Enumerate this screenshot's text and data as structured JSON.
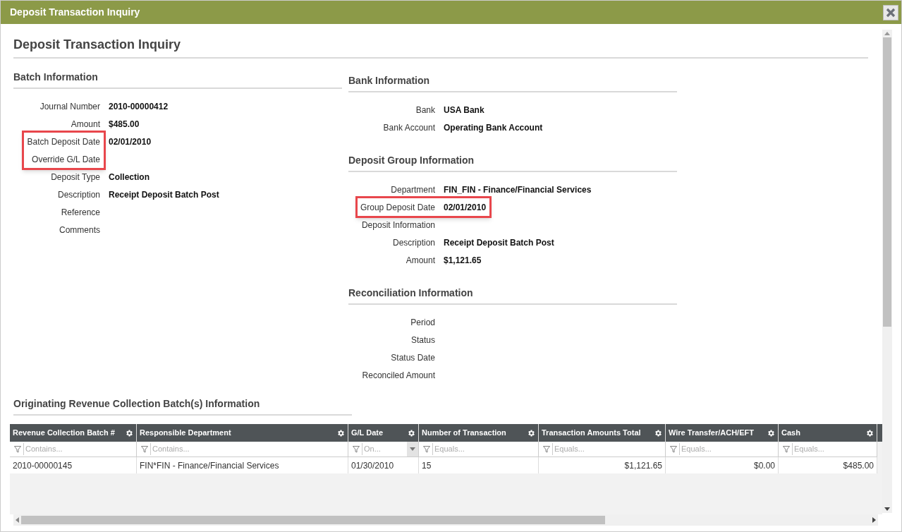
{
  "window": {
    "title": "Deposit Transaction Inquiry"
  },
  "page_title": "Deposit Transaction Inquiry",
  "left_sections": [
    {
      "title": "Batch Information",
      "fields": [
        {
          "label": "Journal Number",
          "value": "2010-00000412"
        },
        {
          "label": "Amount",
          "value": "$485.00"
        },
        {
          "label": "Batch Deposit Date",
          "value": "02/01/2010",
          "label_highlighted": true,
          "value_highlighted": false
        },
        {
          "label": "Override G/L Date",
          "label_highlighted": true,
          "value_highlighted": false
        },
        {
          "label": "Deposit Type",
          "value": "Collection"
        },
        {
          "label": "Description",
          "value": "Receipt Deposit Batch Post"
        },
        {
          "label": "Reference"
        },
        {
          "label": "Comments"
        }
      ]
    }
  ],
  "right_sections": [
    {
      "title": "Bank Information",
      "fields": [
        {
          "label": "Bank",
          "value": "USA Bank"
        },
        {
          "label": "Bank Account",
          "value": "Operating Bank Account"
        }
      ]
    },
    {
      "title": "Deposit Group Information",
      "fields": [
        {
          "label": "Department",
          "value": "FIN_FIN - Finance/Financial Services"
        },
        {
          "label": "Group Deposit Date",
          "value": "02/01/2010",
          "label_highlighted": true,
          "value_highlighted": true
        },
        {
          "label": "Deposit Information"
        },
        {
          "label": "Description",
          "value": "Receipt Deposit Batch Post"
        },
        {
          "label": "Amount",
          "value": "$1,121.65"
        }
      ]
    },
    {
      "title": "Reconciliation Information",
      "fields": [
        {
          "label": "Period"
        },
        {
          "label": "Status"
        },
        {
          "label": "Status Date"
        },
        {
          "label": "Reconciled Amount"
        }
      ]
    }
  ],
  "grid_title": "Originating Revenue Collection Batch(s) Information",
  "table": {
    "columns": [
      {
        "title": "Revenue Collection Batch #",
        "filter": "Contains...",
        "align_right": false,
        "dropdown": false
      },
      {
        "title": "Responsible Department",
        "filter": "Contains...",
        "align_right": false,
        "dropdown": false
      },
      {
        "title": "G/L Date",
        "filter": "On...",
        "align_right": false,
        "dropdown": true
      },
      {
        "title": "Number of Transaction",
        "filter": "Equals...",
        "align_right": false,
        "dropdown": false
      },
      {
        "title": "Transaction Amounts Total",
        "filter": "Equals...",
        "align_right": true,
        "dropdown": false
      },
      {
        "title": "Wire Transfer/ACH/EFT",
        "filter": "Equals...",
        "align_right": true,
        "dropdown": false
      },
      {
        "title": "Cash",
        "filter": "Equals...",
        "align_right": true,
        "dropdown": false
      }
    ],
    "rows": [
      [
        "2010-00000145",
        "FIN*FIN - Finance/Financial Services",
        "01/30/2010",
        "15",
        "$1,121.65",
        "$0.00",
        "$485.00"
      ]
    ]
  }
}
